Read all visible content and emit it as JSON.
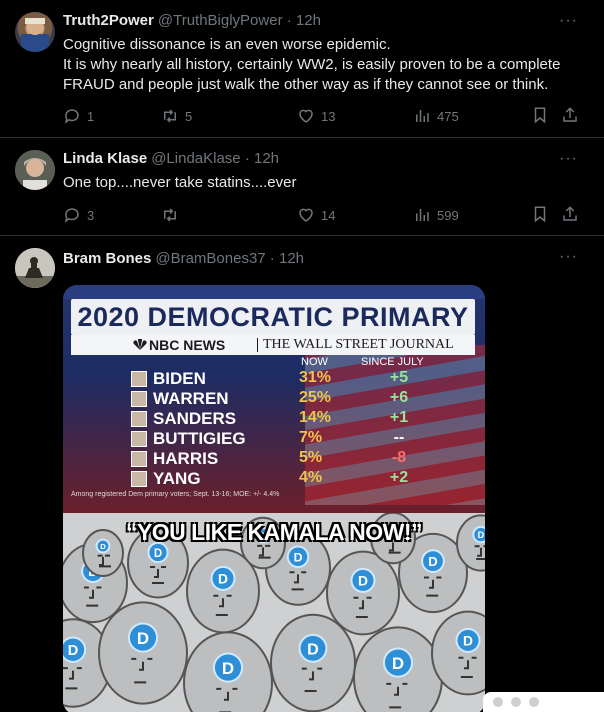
{
  "tweets": [
    {
      "name": "Truth2Power",
      "meta": "@TruthBiglyPower · 12h",
      "lines": [
        "Cognitive dissonance is an even worse epidemic.",
        "It is why nearly all history, certainly WW2, is easily proven to be a complete",
        "FRAUD and people just walk the other way as if they cannot see or think."
      ],
      "replies": "1",
      "retweets": "5",
      "likes": "13",
      "views": "475"
    },
    {
      "name": "Linda Klase",
      "meta": "@LindaKlase · 12h",
      "lines": [
        "One top....never take statins....ever"
      ],
      "replies": "3",
      "retweets": "",
      "likes": "14",
      "views": "599"
    },
    {
      "name": "Bram Bones",
      "meta": "@BramBones37 · 12h"
    }
  ],
  "more_glyph": "···",
  "poll": {
    "title": "2020 DEMOCRATIC PRIMARY",
    "source1": "NBC NEWS",
    "source2": "THE WALL STREET JOURNAL",
    "col_now": "NOW",
    "col_since": "SINCE JULY",
    "candidates": [
      {
        "name": "BIDEN",
        "now": "31%",
        "since": "+5"
      },
      {
        "name": "WARREN",
        "now": "25%",
        "since": "+6"
      },
      {
        "name": "SANDERS",
        "now": "14%",
        "since": "+1"
      },
      {
        "name": "BUTTIGIEG",
        "now": "7%",
        "since": "--"
      },
      {
        "name": "HARRIS",
        "now": "5%",
        "since": "-8"
      },
      {
        "name": "YANG",
        "now": "4%",
        "since": "+2"
      }
    ],
    "footnote": "Among registered Dem primary voters; Sept. 13-16; MOE: +/- 4.4%",
    "colors": {
      "up": "#9be39b",
      "down": "#ff6b6b",
      "flat": "#ffffff"
    }
  },
  "meme": {
    "caption": "“YOU LIKE KAMALA NOW!”",
    "badge_letter": "D"
  }
}
